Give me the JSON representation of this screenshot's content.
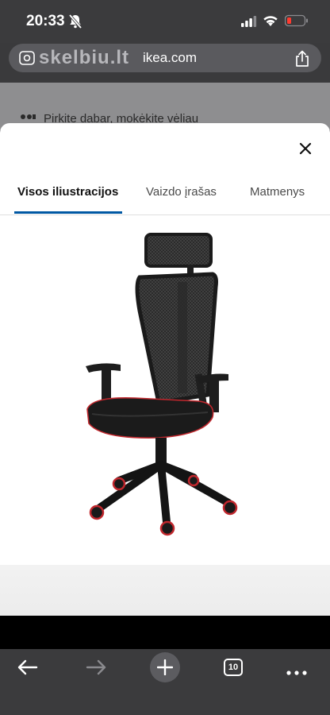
{
  "status_bar": {
    "time": "20:33"
  },
  "browser": {
    "url_logo": "skelbiu.lt",
    "url_text": "ikea.com",
    "tab_count": "10"
  },
  "page": {
    "promo_text": "Pirkite dabar, mokėkite vėliau"
  },
  "modal": {
    "tabs": [
      {
        "label": "Visos iliustracijos"
      },
      {
        "label": "Vaizdo įrašas"
      },
      {
        "label": "Matmenys"
      }
    ],
    "active_tab_index": 0,
    "image_alt": "Office chair with headrest",
    "accent_color": "#0058a3",
    "chair_accent_color": "#c0272d"
  },
  "icons": {
    "status": [
      "bell-muted-icon",
      "cellular-signal-icon",
      "wifi-icon",
      "battery-low-icon"
    ],
    "url_bar": [
      "page-settings-icon",
      "share-icon"
    ],
    "modal": [
      "close-icon"
    ],
    "toolbar": [
      "back-arrow-icon",
      "forward-arrow-icon",
      "new-tab-plus-icon",
      "tabs-icon",
      "more-icon"
    ]
  }
}
